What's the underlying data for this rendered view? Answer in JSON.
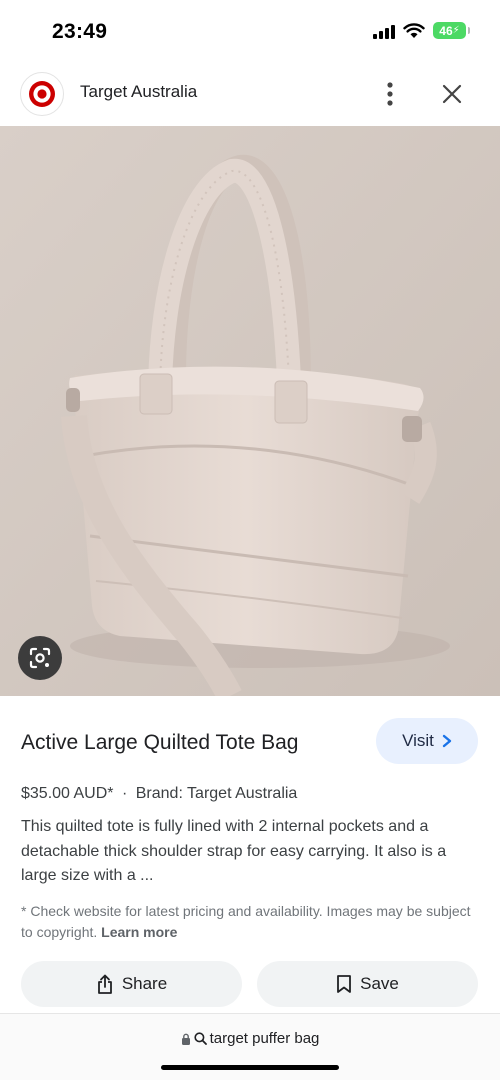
{
  "status_bar": {
    "time": "23:49",
    "battery": "46"
  },
  "header": {
    "site_name": "Target Australia"
  },
  "product": {
    "title": "Active Large Quilted Tote Bag",
    "visit_label": "Visit",
    "price": "$35.00 AUD*",
    "separator": "·",
    "brand": "Brand: Target Australia",
    "description": "This quilted tote is fully lined with 2 internal pockets and a detachable thick shoulder strap for easy carrying. It also is a large size with a ...",
    "disclaimer": "* Check website for latest pricing and availability. Images may be subject to copyright.",
    "learn_more": "Learn more"
  },
  "actions": {
    "share_label": "Share",
    "save_label": "Save"
  },
  "url_bar": {
    "query": "target puffer bag"
  },
  "colors": {
    "brand_red": "#cc0000",
    "visit_bg": "#e8f0fe",
    "accent_blue": "#1a73e8",
    "button_bg": "#f1f3f4"
  },
  "icons": [
    "cellular-signal-icon",
    "wifi-icon",
    "battery-icon",
    "target-logo-icon",
    "more-vert-icon",
    "close-icon",
    "lens-icon",
    "chevron-right-icon",
    "share-icon",
    "bookmark-icon",
    "lock-icon",
    "search-icon"
  ]
}
